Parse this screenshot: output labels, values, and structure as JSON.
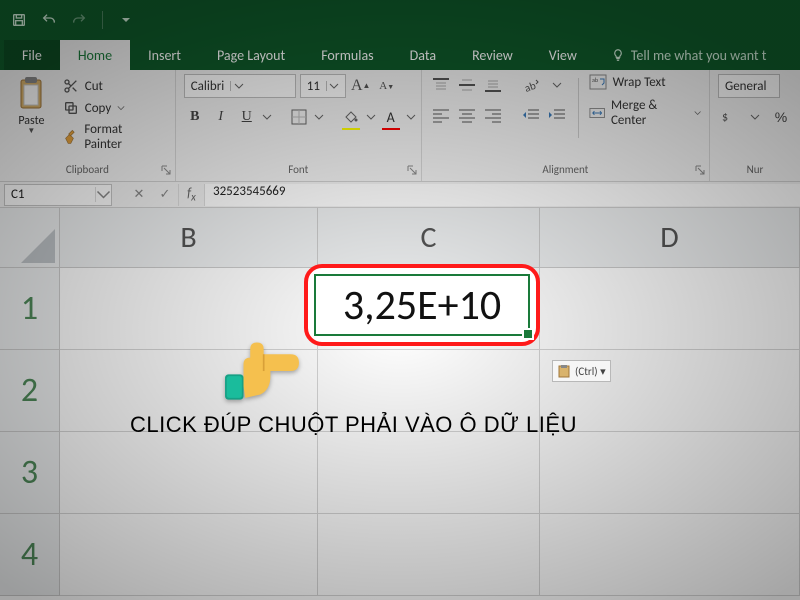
{
  "qat": {
    "save": "save-icon",
    "undo": "undo-icon",
    "redo": "redo-icon"
  },
  "tabs": [
    "File",
    "Home",
    "Insert",
    "Page Layout",
    "Formulas",
    "Data",
    "Review",
    "View"
  ],
  "tell_me": "Tell me what you want t",
  "clipboard": {
    "paste": "Paste",
    "cut": "Cut",
    "copy": "Copy",
    "format_painter": "Format Painter",
    "group_label": "Clipboard"
  },
  "font": {
    "name": "Calibri",
    "size": "11",
    "group_label": "Font"
  },
  "alignment": {
    "wrap": "Wrap Text",
    "merge": "Merge & Center",
    "group_label": "Alignment"
  },
  "number": {
    "format": "General",
    "group_label": "Nur"
  },
  "namebox": "C1",
  "formula_value": "32523545669",
  "columns": [
    "B",
    "C",
    "D"
  ],
  "rows": [
    "1",
    "2",
    "3",
    "4"
  ],
  "cell_c1_display": "3,25E+10",
  "paste_options": "(Ctrl) ▾",
  "instruction": "Click đúp chuột phải vào ô dữ liệu"
}
